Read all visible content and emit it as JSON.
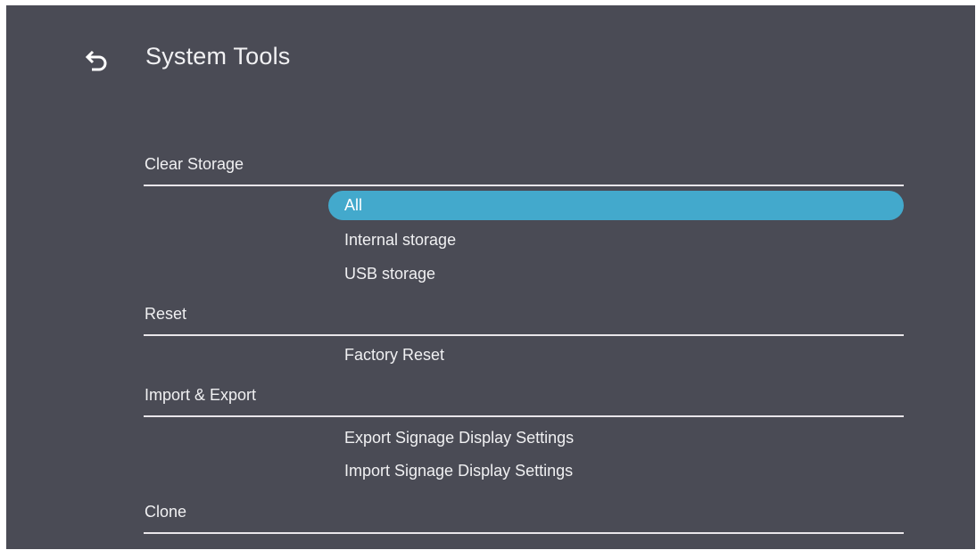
{
  "header": {
    "back_icon": "back-arrow-icon",
    "title": "System Tools"
  },
  "colors": {
    "background": "#4a4b55",
    "highlight": "#43a9cc",
    "text": "#f0f0f2",
    "divider": "#e9e6ea"
  },
  "sections": {
    "clear_storage": {
      "label": "Clear Storage",
      "options": {
        "all": "All",
        "internal": "Internal storage",
        "usb": "USB storage"
      },
      "selected": "All"
    },
    "reset": {
      "label": "Reset",
      "options": {
        "factory": "Factory Reset"
      }
    },
    "import_export": {
      "label": "Import & Export",
      "options": {
        "export": "Export Signage Display Settings",
        "import": "Import Signage Display Settings"
      }
    },
    "clone": {
      "label": "Clone"
    }
  }
}
